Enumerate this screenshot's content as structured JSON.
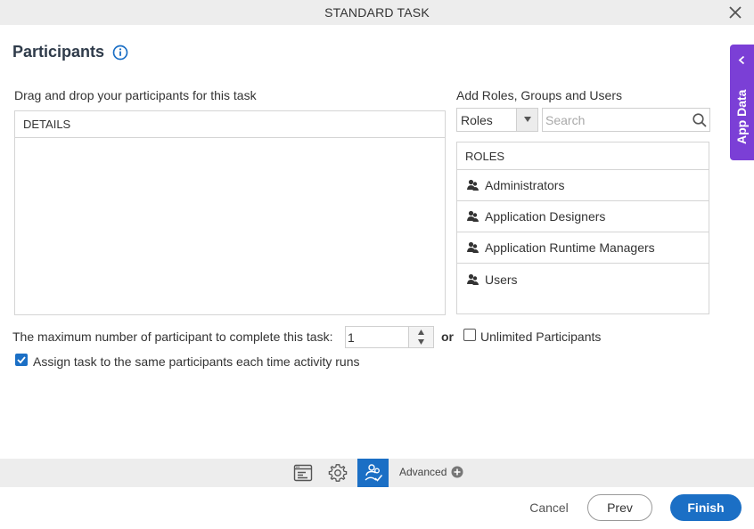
{
  "window": {
    "title": "STANDARD TASK"
  },
  "page": {
    "heading": "Participants"
  },
  "app_data_tab": {
    "label": "App Data"
  },
  "left_panel": {
    "instruction": "Drag and drop your participants for this task",
    "details_header": "DETAILS"
  },
  "right_panel": {
    "title": "Add Roles, Groups and Users",
    "type_select": {
      "value": "Roles"
    },
    "search": {
      "placeholder": "Search",
      "value": ""
    },
    "list_header": "ROLES",
    "items": [
      {
        "label": "Administrators"
      },
      {
        "label": "Application Designers"
      },
      {
        "label": "Application Runtime Managers"
      },
      {
        "label": "Users"
      }
    ]
  },
  "max_participants": {
    "label": "The maximum number of participant to complete this task:",
    "value": "1",
    "or_label": "or",
    "unlimited_label": "Unlimited Participants",
    "unlimited_checked": false
  },
  "assign_same": {
    "label": "Assign task to the same participants each time activity runs",
    "checked": true
  },
  "toolbar": {
    "advanced_label": "Advanced"
  },
  "buttons": {
    "cancel": "Cancel",
    "prev": "Prev",
    "finish": "Finish"
  },
  "colors": {
    "accent": "#1b6fc5",
    "app_data_tab": "#7b3fd6",
    "toolbar_bg": "#ededed"
  }
}
